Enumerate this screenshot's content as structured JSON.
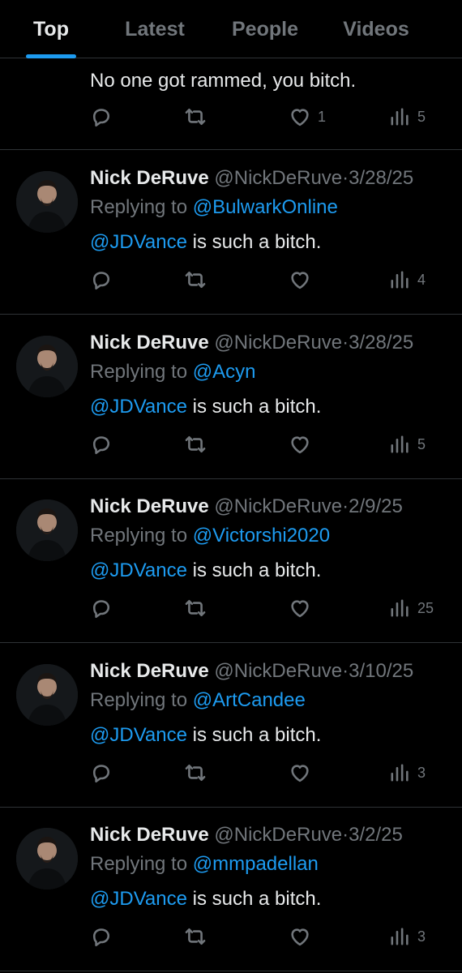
{
  "tabs": [
    {
      "label": "Top",
      "active": true
    },
    {
      "label": "Latest",
      "active": false
    },
    {
      "label": "People",
      "active": false
    },
    {
      "label": "Videos",
      "active": false
    }
  ],
  "partial_tweet": {
    "text": "No one got rammed, you bitch.",
    "like_count": "1",
    "view_count": "5"
  },
  "tweets": [
    {
      "name": "Nick DeRuve",
      "handle": "@NickDeRuve",
      "separator": "·",
      "date": "3/28/25",
      "replying_prefix": "Replying to",
      "replying_to": "@BulwarkOnline",
      "mention": "@JDVance",
      "text": " is such a bitch.",
      "view_count": "4"
    },
    {
      "name": "Nick DeRuve",
      "handle": "@NickDeRuve",
      "separator": "·",
      "date": "3/28/25",
      "replying_prefix": "Replying to",
      "replying_to": "@Acyn",
      "mention": "@JDVance",
      "text": " is such a bitch.",
      "view_count": "5"
    },
    {
      "name": "Nick DeRuve",
      "handle": "@NickDeRuve",
      "separator": "·",
      "date": "2/9/25",
      "replying_prefix": "Replying to",
      "replying_to": "@Victorshi2020",
      "mention": "@JDVance",
      "text": " is such a bitch.",
      "view_count": "25"
    },
    {
      "name": "Nick DeRuve",
      "handle": "@NickDeRuve",
      "separator": "·",
      "date": "3/10/25",
      "replying_prefix": "Replying to",
      "replying_to": "@ArtCandee",
      "mention": "@JDVance",
      "text": " is such a bitch.",
      "view_count": "3"
    },
    {
      "name": "Nick DeRuve",
      "handle": "@NickDeRuve",
      "separator": "·",
      "date": "3/2/25",
      "replying_prefix": "Replying to",
      "replying_to": "@mmpadellan",
      "mention": "@JDVance",
      "text": " is such a bitch.",
      "view_count": "3"
    }
  ],
  "icons": {
    "reply": "reply-icon",
    "retweet": "retweet-icon",
    "like": "heart-icon",
    "views": "views-chart-icon"
  },
  "colors": {
    "background": "#000000",
    "accent": "#1d9bf0",
    "muted": "#71767b",
    "text": "#e7e9ea",
    "divider": "#2f3336"
  }
}
